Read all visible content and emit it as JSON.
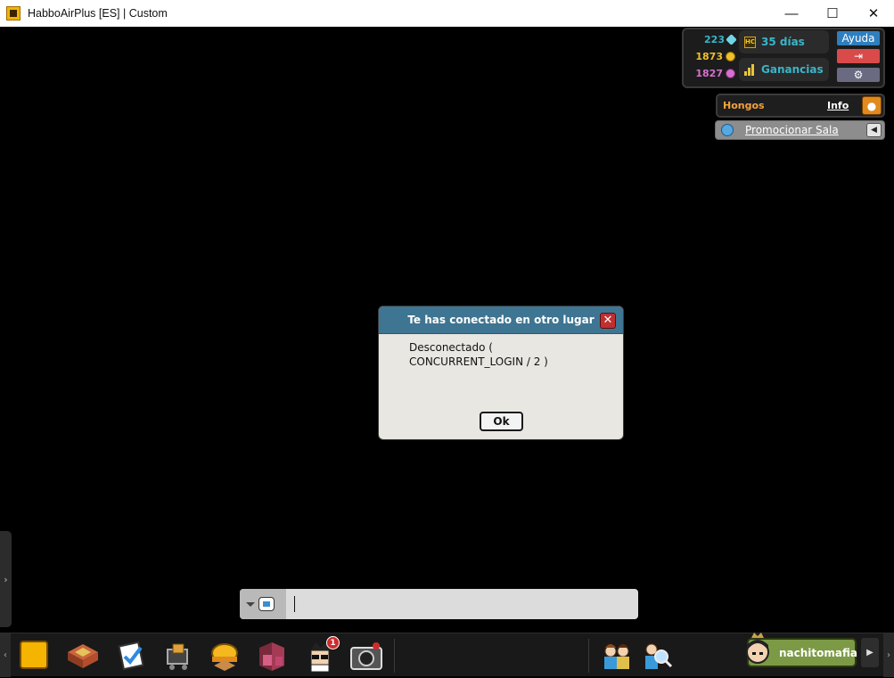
{
  "window": {
    "title": "HabboAirPlus [ES] | Custom",
    "controls": {
      "minimize": "—",
      "maximize": "☐",
      "close": "✕"
    }
  },
  "hud": {
    "diamonds": "223",
    "credits": "1873",
    "duckets": "1827",
    "hc_days": "35 días",
    "earnings": "Ganancias",
    "help_label": "Ayuda",
    "logout_icon": "logout-icon",
    "settings_icon": "gear-icon",
    "colors": {
      "diamonds": "#3ab5c9",
      "credits": "#f0c02a",
      "duckets": "#d86fd0",
      "help": "#2f7fbf",
      "logout": "#d94a4a",
      "settings": "#6a6a82"
    }
  },
  "hongos": {
    "label": "Hongos",
    "info": "Info"
  },
  "promote": {
    "label": "Promocionar Sala"
  },
  "dialog": {
    "title": "Te has conectado en otro lugar",
    "message_line1": "Desconectado (",
    "message_line2": "CONCURRENT_LOGIN / 2 )",
    "ok_label": "Ok",
    "close_glyph": "✕"
  },
  "chat": {
    "value": "",
    "placeholder": ""
  },
  "toolbar": {
    "icons": [
      "habbo-logo-icon",
      "rooms-icon",
      "catalog-icon",
      "shop-icon",
      "builder-icon",
      "inventory-icon",
      "profile-icon",
      "camera-icon",
      "friends-icon",
      "search-friends-icon"
    ],
    "notification_count": "1",
    "username": "nachitomafia"
  }
}
